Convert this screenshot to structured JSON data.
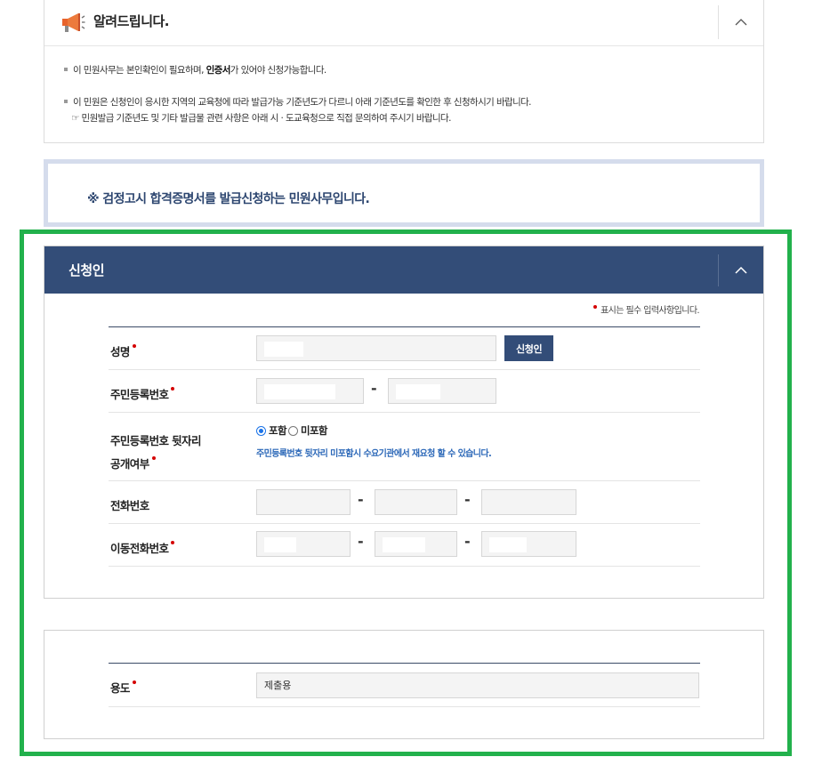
{
  "notice": {
    "title": "알려드립니다.",
    "line1_pre": "이 민원사무는 본인확인이 필요하며, ",
    "line1_bold": "인증서",
    "line1_post": "가 있어야 신청가능합니다.",
    "line2": "이 민원은 신청인이 응시한 지역의 교육청에 따라 발급가능 기준년도가 다르니 아래 기준년도를 확인한 후 신청하시기 바랍니다.",
    "line3": "☞ 민원발급 기준년도 및 기타 발급물 관련 사항은 아래 시 · 도교육청으로 직접 문의하여 주시기 바랍니다.",
    "icon": "megaphone-icon"
  },
  "banner": {
    "text": "※ 검정고시 합격증명서를 발급신청하는 민원사무입니다."
  },
  "applicant": {
    "title": "신청인",
    "required_note": "표시는 필수 입력사항입니다.",
    "name_label": "성명",
    "applicant_button": "신청인",
    "rrn_label": "주민등록번호",
    "rrn_back_label_line1": "주민등록번호 뒷자리",
    "rrn_back_label_line2": "공개여부",
    "include_label": "포함",
    "exclude_label": "미포함",
    "rrn_help": "주민등록번호 뒷자리 미포함시 수요기관에서 재요청 할 수 있습니다.",
    "phone_label": "전화번호",
    "mobile_label": "이동전화번호",
    "separator": "-"
  },
  "purpose": {
    "label": "용도",
    "value": "제출용"
  },
  "colors": {
    "header_navy": "#334d78",
    "highlight_green": "#22b14c",
    "required_red": "#d40000",
    "help_blue": "#2c68b8"
  }
}
